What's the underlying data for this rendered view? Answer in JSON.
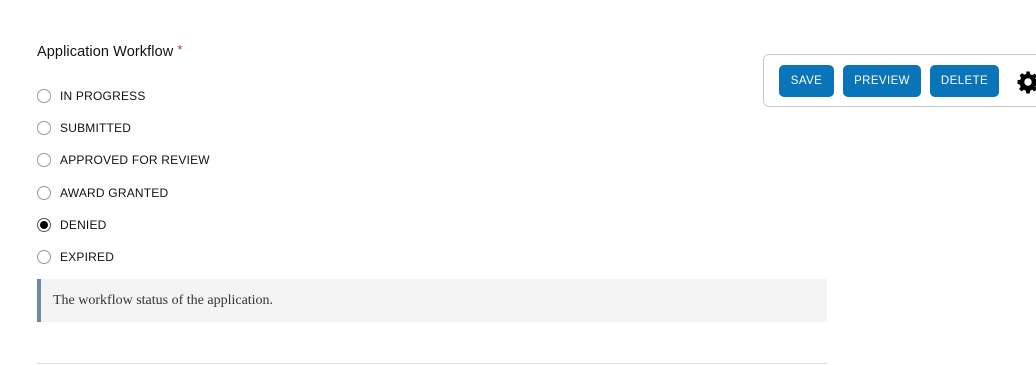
{
  "field": {
    "label": "Application Workflow",
    "required_marker": "*",
    "help_text": "The workflow status of the application."
  },
  "options": [
    {
      "label": "IN PROGRESS",
      "checked": false
    },
    {
      "label": "SUBMITTED",
      "checked": false
    },
    {
      "label": "APPROVED FOR REVIEW",
      "checked": false
    },
    {
      "label": "AWARD GRANTED",
      "checked": false
    },
    {
      "label": "DENIED",
      "checked": true
    },
    {
      "label": "EXPIRED",
      "checked": false
    }
  ],
  "toolbar": {
    "save_label": "SAVE",
    "preview_label": "PREVIEW",
    "delete_label": "DELETE",
    "settings_icon": "gear-icon"
  },
  "colors": {
    "button_bg": "#0a74b9",
    "required": "#c0392b",
    "help_border": "#6b8aa6",
    "help_bg": "#f4f4f4"
  }
}
